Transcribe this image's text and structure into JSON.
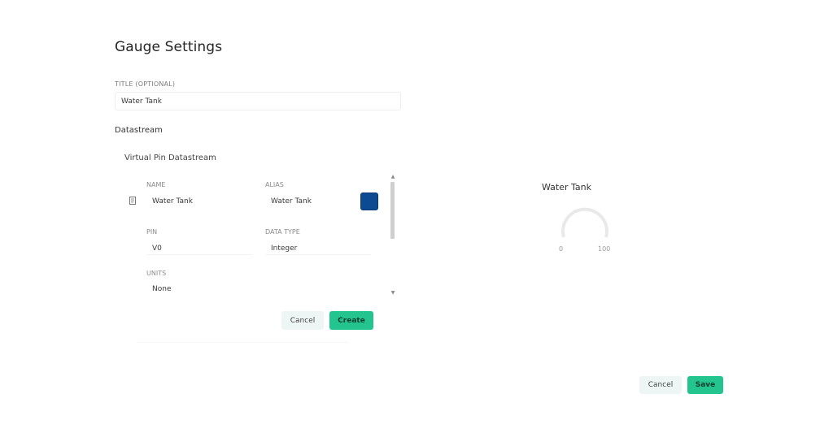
{
  "page": {
    "title": "Gauge Settings"
  },
  "title_field": {
    "label": "TITLE (OPTIONAL)",
    "value": "Water Tank"
  },
  "datastream": {
    "section_title": "Datastream",
    "subsection_title": "Virtual Pin Datastream",
    "name": {
      "label": "NAME",
      "value": "Water Tank"
    },
    "alias": {
      "label": "ALIAS",
      "value": "Water Tank"
    },
    "pin": {
      "label": "PIN",
      "value": "V0"
    },
    "data_type": {
      "label": "DATA TYPE",
      "value": "Integer"
    },
    "units": {
      "label": "UNITS",
      "value": "None"
    },
    "color": "#0d4a91",
    "cancel_label": "Cancel",
    "create_label": "Create"
  },
  "preview": {
    "title": "Water Tank",
    "min": "0",
    "max": "100"
  },
  "footer": {
    "cancel_label": "Cancel",
    "save_label": "Save"
  },
  "colors": {
    "accent": "#23c48e",
    "cancel_bg": "#eef6f5"
  }
}
